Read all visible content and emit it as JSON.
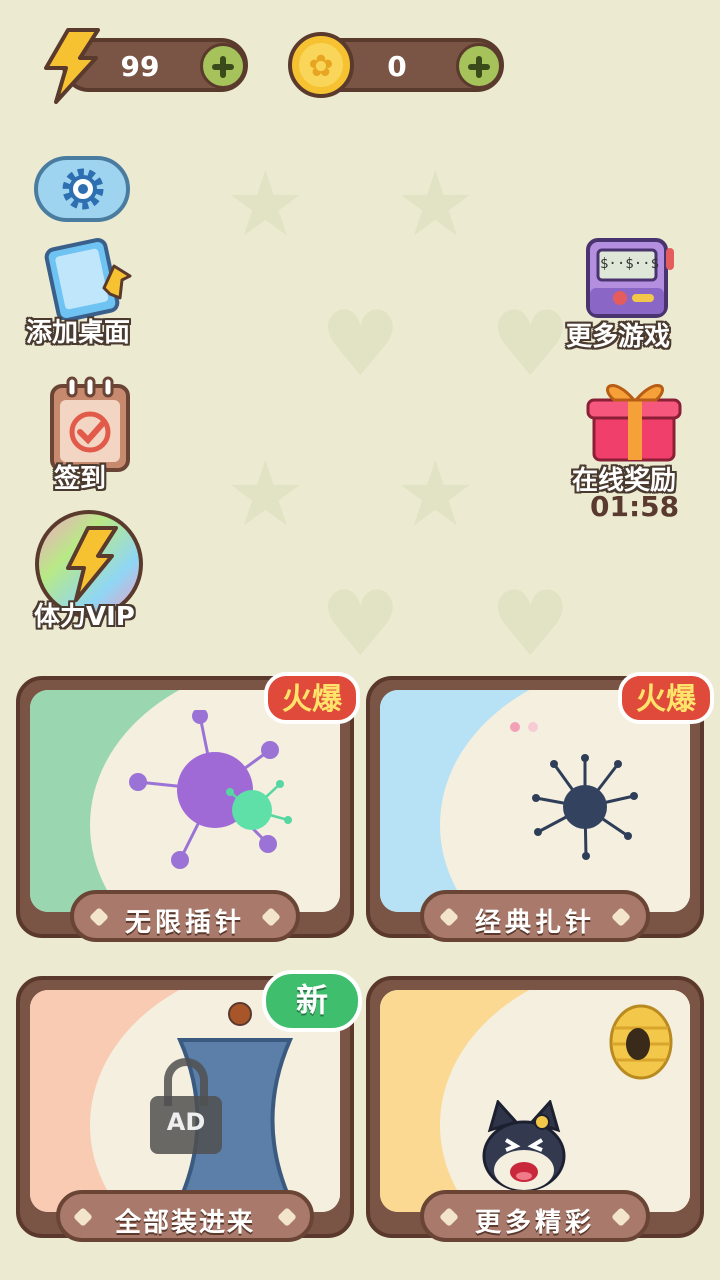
{
  "hud": {
    "energy_value": "99",
    "coins_value": "0"
  },
  "side_left": {
    "settings_label": "",
    "add_desktop_label": "添加桌面",
    "checkin_label": "签到",
    "vip_label": "体力VIP"
  },
  "side_right": {
    "more_games_label": "更多游戏",
    "online_reward_label": "在线奖励",
    "online_reward_timer": "01:58",
    "arcade_screen_text": "$··$··$"
  },
  "cards": [
    {
      "title": "无限插针",
      "badge": "火爆"
    },
    {
      "title": "经典扎针",
      "badge": "火爆"
    },
    {
      "title": "全部装进来",
      "badge": "新",
      "lock_text": "AD"
    },
    {
      "title": "更多精彩",
      "badge": ""
    }
  ],
  "colors": {
    "background": "#ecebd2",
    "card_frame": "#7a5545",
    "hot_badge": "#e04a3a",
    "new_badge": "#3fbf6e",
    "plus_button": "#a6c25b"
  }
}
